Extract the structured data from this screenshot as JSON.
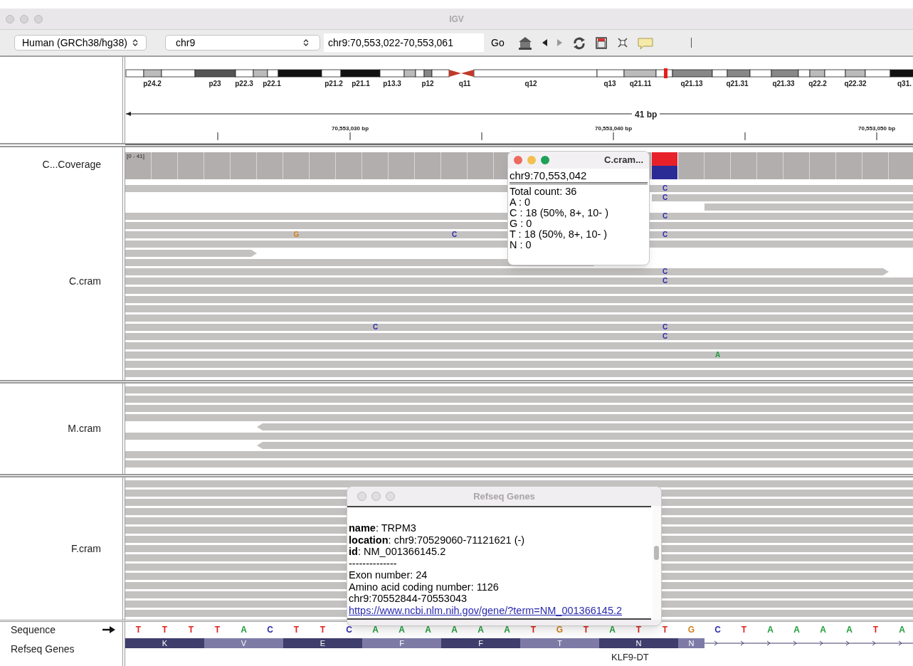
{
  "window": {
    "title": "IGV"
  },
  "toolbar": {
    "genome": "Human (GRCh38/hg38)",
    "chromosome": "chr9",
    "locus": "chr9:70,553,022-70,553,061",
    "go": "Go"
  },
  "ideogram": {
    "bands": [
      "p24.2",
      "p23",
      "p22.3",
      "p22.1",
      "p21.2",
      "p21.1",
      "p13.3",
      "p12",
      "q11",
      "q12",
      "q13",
      "q21.11",
      "q21.13",
      "q21.31",
      "q21.33",
      "q22.2",
      "q22.32",
      "q31."
    ]
  },
  "ruler": {
    "span": "41 bp",
    "tick_labels": [
      "70,553,030 bp",
      "70,553,040 bp",
      "70,553,050 bp"
    ]
  },
  "panels": [
    {
      "tracks": [
        {
          "kind": "coverage",
          "name": "C...Coverage",
          "range": "[0 - 41]",
          "alleles": [
            {
              "color": "#e8202a"
            },
            {
              "color": "#2b2b96"
            }
          ]
        },
        {
          "kind": "alignment",
          "name": "C.cram",
          "mismatches": [
            {
              "base": "C"
            },
            {
              "base": "C"
            },
            {
              "base": "C"
            },
            {
              "base": "G"
            },
            {
              "base": "C"
            },
            {
              "base": "C"
            },
            {
              "base": "C"
            },
            {
              "base": "C"
            },
            {
              "base": "C"
            },
            {
              "base": "C"
            },
            {
              "base": "C"
            },
            {
              "base": "A"
            }
          ]
        }
      ]
    },
    {
      "tracks": [
        {
          "kind": "alignment",
          "name": "M.cram"
        }
      ]
    },
    {
      "tracks": [
        {
          "kind": "alignment",
          "name": "F.cram"
        }
      ]
    }
  ],
  "sequence": {
    "name": "Sequence",
    "bases": [
      "T",
      "T",
      "T",
      "T",
      "A",
      "C",
      "T",
      "T",
      "C",
      "A",
      "A",
      "A",
      "A",
      "A",
      "A",
      "T",
      "G",
      "T",
      "A",
      "T",
      "T",
      "G",
      "C",
      "T",
      "A",
      "A",
      "A",
      "A",
      "T",
      "A"
    ]
  },
  "refseq": {
    "name": "Refseq Genes",
    "gene": "KLF9-DT",
    "codons": [
      {
        "aa": "K",
        "color": "#3e3d6c",
        "kind": "codon"
      },
      {
        "aa": "V",
        "color": "#7d7ba6",
        "kind": "codon"
      },
      {
        "aa": "E",
        "color": "#3e3d6c",
        "kind": "codon"
      },
      {
        "aa": "F",
        "color": "#7d7ba6",
        "kind": "codon"
      },
      {
        "aa": "F",
        "color": "#3e3d6c",
        "kind": "codon"
      },
      {
        "aa": "T",
        "color": "#7d7ba6",
        "kind": "codon"
      },
      {
        "aa": "N",
        "color": "#3e3d6c",
        "kind": "codon"
      },
      {
        "aa": "N",
        "color": "#7d7ba6",
        "kind": "partial"
      }
    ]
  },
  "coverage_popup": {
    "title": "C.cram...",
    "location": "chr9:70,553,042",
    "lines": [
      "Total count: 36",
      "A : 0",
      "C : 18 (50%, 8+, 10- )",
      "G : 0",
      "T : 18 (50%, 8+, 10- )",
      "N : 0"
    ]
  },
  "gene_popup": {
    "title": "Refseq Genes",
    "lines": [
      {
        "kind": "text",
        "text": "**name**: TRPM3"
      },
      {
        "kind": "text",
        "text": "**location**: chr9:70529060-71121621 (-)"
      },
      {
        "kind": "text",
        "text": "**id**: NM_001366145.2"
      },
      {
        "kind": "text",
        "text": "--------------"
      },
      {
        "kind": "text",
        "text": "Exon number: 24"
      },
      {
        "kind": "text",
        "text": "Amino acid coding number: 1126"
      },
      {
        "kind": "text",
        "text": "chr9:70552844-70553043"
      },
      {
        "kind": "link",
        "text": "https://www.ncbi.nlm.nih.gov/gene/?term=NM_001366145.2"
      }
    ]
  }
}
